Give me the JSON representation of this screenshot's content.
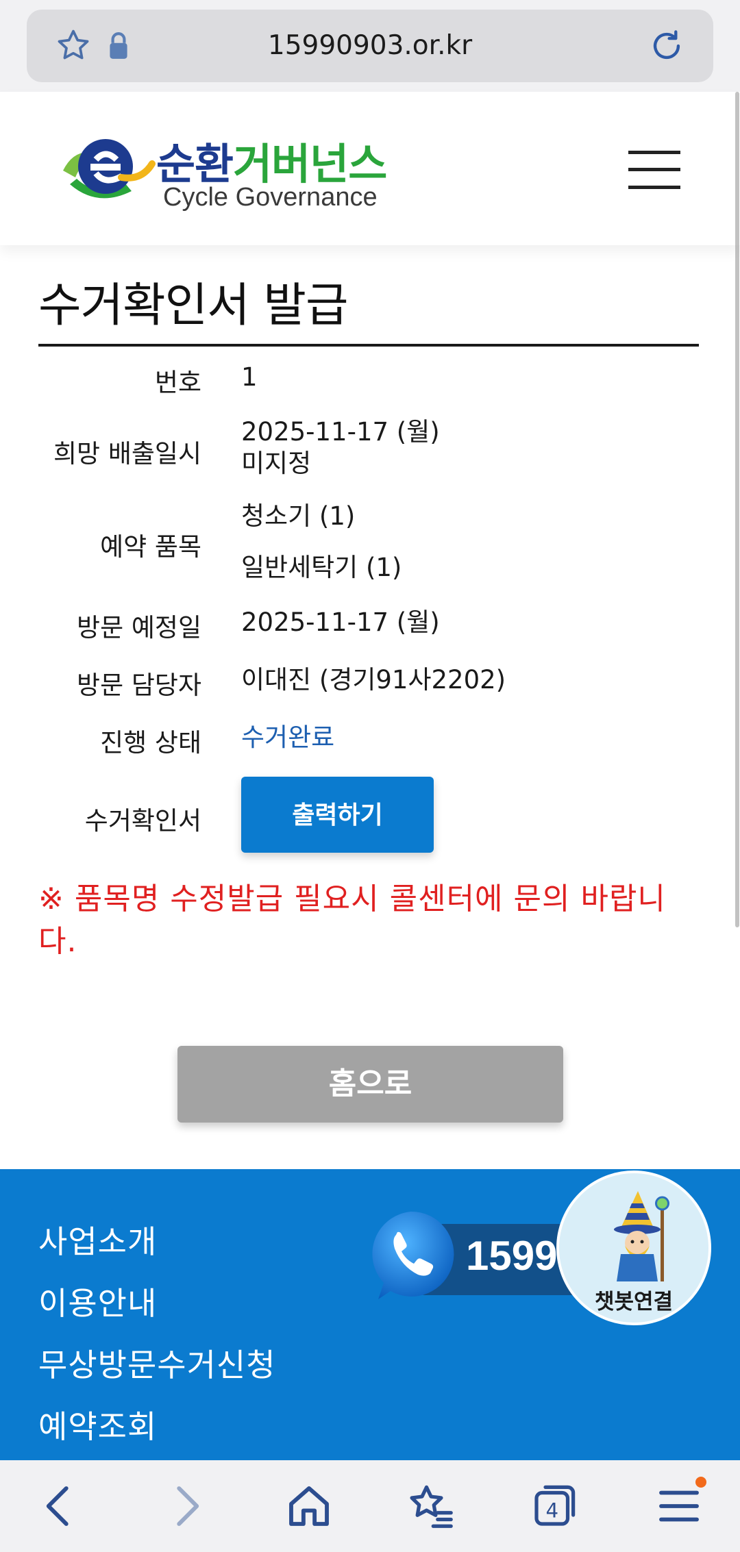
{
  "browser": {
    "url": "15990903.or.kr",
    "tab_count": "4"
  },
  "header": {
    "logo_ko_part1": "순환",
    "logo_ko_part2": "거버넌스",
    "logo_en": "Cycle Governance"
  },
  "page": {
    "title": "수거확인서 발급",
    "rows": [
      {
        "label": "번호",
        "values": [
          "1"
        ]
      },
      {
        "label": "희망 배출일시",
        "values": [
          "2025-11-17 (월)",
          "미지정"
        ]
      },
      {
        "label": "예약 품목",
        "values": [
          "청소기 (1)",
          "일반세탁기 (1)"
        ]
      },
      {
        "label": "방문 예정일",
        "values": [
          "2025-11-17 (월)"
        ]
      },
      {
        "label": "방문 담당자",
        "values": [
          "이대진 (경기91사2202)"
        ]
      },
      {
        "label": "진행 상태",
        "values": [
          "수거완료"
        ]
      },
      {
        "label": "수거확인서",
        "values": []
      }
    ],
    "print_button": "출력하기",
    "notice": "※ 품목명 수정발급 필요시 콜센터에 문의 바랍니다.",
    "home_button": "홈으로"
  },
  "footer": {
    "links": [
      "사업소개",
      "이용안내",
      "무상방문수거신청",
      "예약조회"
    ],
    "call_number": "1599",
    "chatbot_label": "챗봇연결"
  },
  "colors": {
    "primary_blue": "#0b7bcf",
    "status_blue": "#1d5fb0",
    "notice_red": "#e02020",
    "home_gray": "#a3a3a3"
  }
}
